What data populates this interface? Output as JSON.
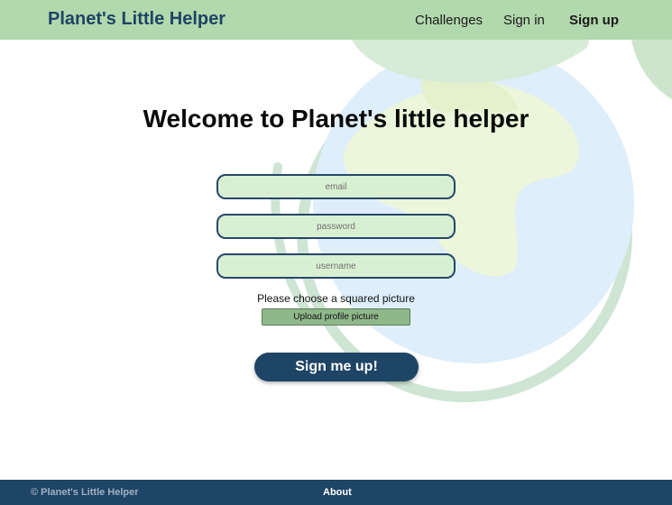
{
  "navbar": {
    "brand": "Planet's Little Helper",
    "links": [
      "Challenges",
      "Sign in",
      "Sign up"
    ]
  },
  "form": {
    "title": "Welcome to Planet's little helper",
    "email_placeholder": "email",
    "password_placeholder": "password",
    "username_placeholder": "username",
    "upload_label": "Please choose a squared picture",
    "upload_button": "Upload profile picture",
    "submit_button": "Sign me up!"
  },
  "footer": {
    "copyright": "© Planet's Little Helper",
    "about": "About"
  },
  "colors": {
    "navbar": "#b2d8ad",
    "brand_text": "#1e4466",
    "input_bg": "#d8f0d2",
    "input_border": "#27466b",
    "upload_button": "#8fb88a",
    "primary_button": "#1e4466",
    "footer": "#1e4466"
  }
}
